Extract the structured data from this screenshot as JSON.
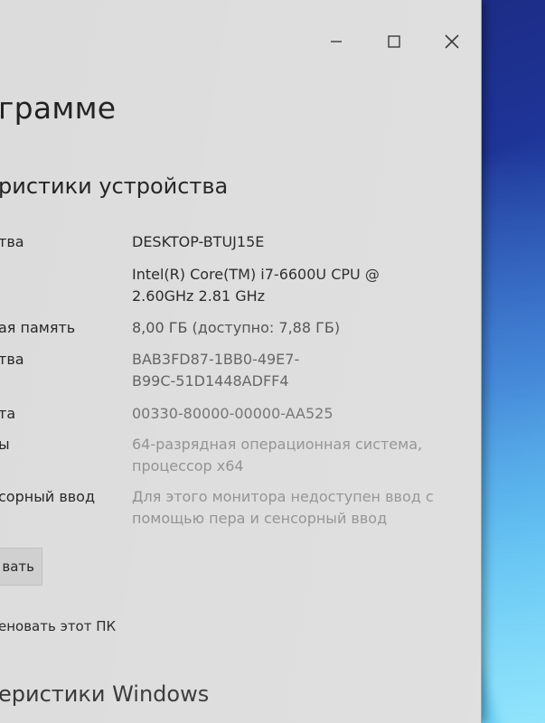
{
  "window_controls": {
    "minimize": "minimize",
    "maximize": "maximize",
    "close": "close"
  },
  "page_title": "грамме",
  "section_title": "ристики устройства",
  "specs": [
    {
      "label": "тва",
      "value": [
        "DESKTOP-BTUJ15E"
      ]
    },
    {
      "label": "",
      "value": [
        "Intel(R) Core(TM) i7-6600U CPU @",
        "2.60GHz   2.81 GHz"
      ]
    },
    {
      "label": "ая память",
      "value": [
        "8,00 ГБ (доступно: 7,88 ГБ)"
      ]
    },
    {
      "label": "тва",
      "value": [
        "BAB3FD87-1BB0-49E7-",
        "B99C-51D1448ADFF4"
      ]
    },
    {
      "label": "та",
      "value": [
        "00330-80000-00000-AA525"
      ]
    },
    {
      "label": "ы",
      "value": [
        "64-разрядная операционная система,",
        "процессор x64"
      ]
    },
    {
      "label": "сорный ввод",
      "value": [
        "Для этого монитора недоступен ввод с",
        "помощью пера и сенсорный ввод"
      ]
    }
  ],
  "copy_button": "вать",
  "rename_link": "еновать этот ПК",
  "windows_specs_title": "еристики Windows",
  "colors": {
    "window_bg": "#dcdcdc",
    "text": "#232323",
    "desktop_accent": "#2a5cc4"
  }
}
